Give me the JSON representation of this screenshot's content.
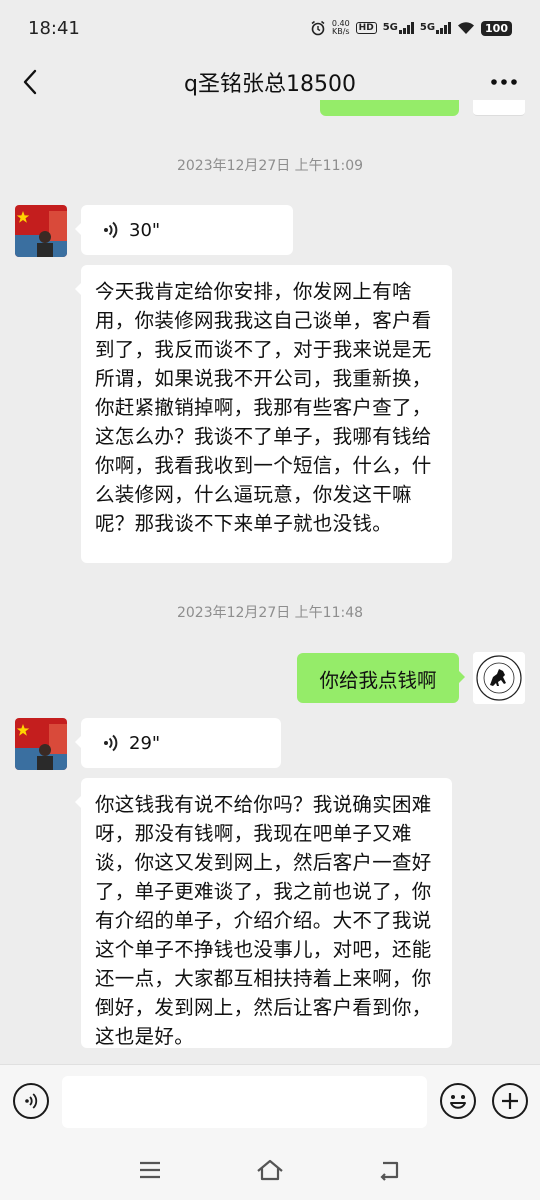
{
  "status_bar": {
    "time": "18:41",
    "net_speed_value": "0.40",
    "net_speed_unit": "KB/s",
    "hd_label": "HD",
    "net1": "5G",
    "net2": "5G",
    "battery": "100"
  },
  "header": {
    "title": "q圣铭张总18500"
  },
  "messages": [
    {
      "kind": "timestamp",
      "text": "2023年12月27日  上午11:09"
    },
    {
      "kind": "voice",
      "side": "left",
      "duration": "30\""
    },
    {
      "kind": "text",
      "side": "left",
      "text": "今天我肯定给你安排，你发网上有啥用，你装修网我我这自己谈单，客户看到了，我反而谈不了，对于我来说是无所谓，如果说我不开公司，我重新换，你赶紧撤销掉啊，我那有些客户查了，这怎么办？我谈不了单子，我哪有钱给你啊，我看我收到一个短信，什么，什么装修网，什么逼玩意，你发这干嘛呢？那我谈不下来单子就也没钱。"
    },
    {
      "kind": "timestamp",
      "text": "2023年12月27日  上午11:48"
    },
    {
      "kind": "text",
      "side": "right",
      "text": "你给我点钱啊"
    },
    {
      "kind": "voice",
      "side": "left",
      "duration": "29\""
    },
    {
      "kind": "text",
      "side": "left",
      "text": "你这钱我有说不给你吗？我说确实困难呀，那没有钱啊，我现在吧单子又难谈，你这又发到网上，然后客户一查好了，单子更难谈了，我之前也说了，你有介绍的单子，介绍介绍。大不了我说这个单子不挣钱也没事儿，对吧，还能还一点，大家都互相扶持着上来啊，你倒好，发到网上，然后让客户看到你，这也是好。"
    }
  ],
  "input": {
    "placeholder": ""
  },
  "icons": {
    "back": "chevron-left-icon",
    "more": "more-dots-icon",
    "voice": "voice-wave-icon",
    "emoji": "smiley-icon",
    "plus": "plus-icon"
  },
  "colors": {
    "background": "#ededed",
    "sent_bubble": "#95ec69",
    "received_bubble": "#ffffff",
    "timestamp": "#8e8e8e"
  }
}
